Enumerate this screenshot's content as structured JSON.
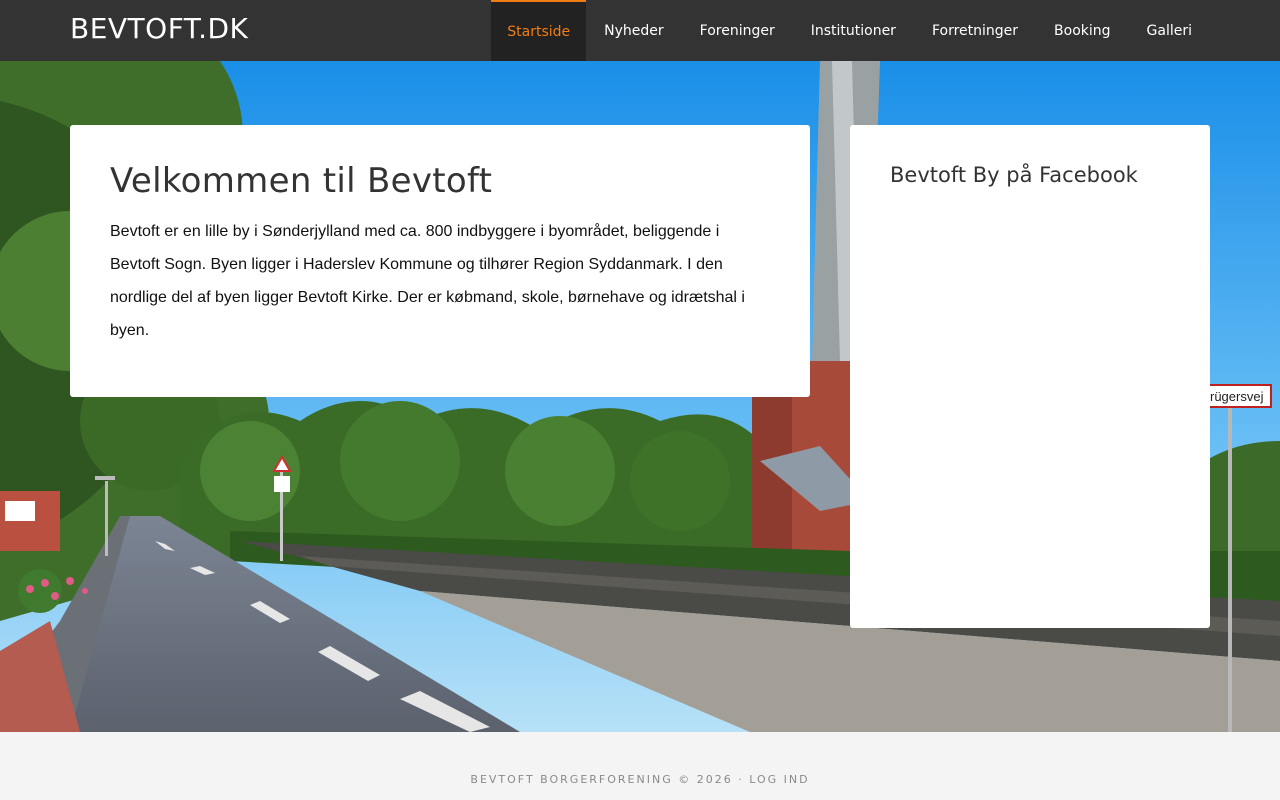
{
  "header": {
    "brand": "BEVTOFT.DK",
    "nav": [
      {
        "label": "Startside",
        "active": true
      },
      {
        "label": "Nyheder"
      },
      {
        "label": "Foreninger"
      },
      {
        "label": "Institutioner"
      },
      {
        "label": "Forretninger"
      },
      {
        "label": "Booking"
      },
      {
        "label": "Galleri"
      }
    ]
  },
  "main": {
    "title": "Velkommen til Bevtoft",
    "body": "Bevtoft er en lille by i Sønderjylland med  ca. 800 indbyggere i byområdet, beliggende i Bevtoft Sogn. Byen ligger i Haderslev Kommune og tilhører Region Syddanmark. I den nordlige del af byen ligger Bevtoft Kirke. Der er købmand, skole, børnehave og idrætshal i byen."
  },
  "sidebar": {
    "title": "Bevtoft By på Facebook"
  },
  "hero": {
    "street_sign": "rügersvej"
  },
  "footer": {
    "copyright": "BEVTOFT BORGERFORENING © 2026 · ",
    "login": "LOG IND"
  },
  "colors": {
    "nav_bg": "#333333",
    "accent": "#f07d14",
    "footer_bg": "#f4f4f4"
  }
}
